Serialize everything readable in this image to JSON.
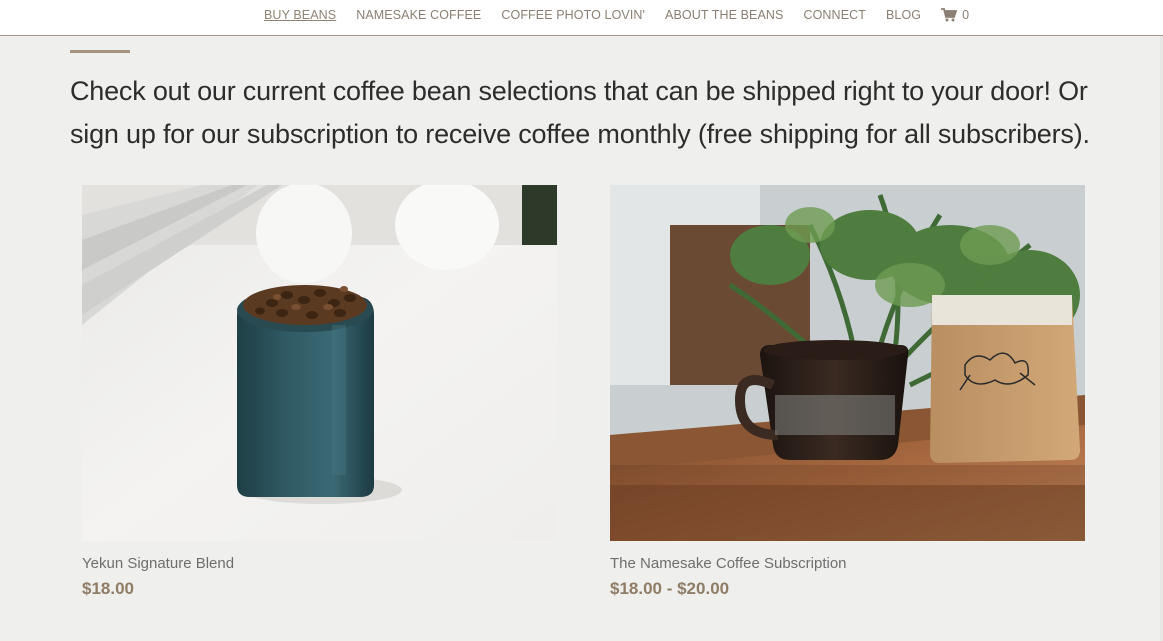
{
  "nav": {
    "items": [
      {
        "label": "BUY BEANS",
        "active": true
      },
      {
        "label": "NAMESAKE COFFEE",
        "active": false
      },
      {
        "label": "COFFEE PHOTO LOVIN'",
        "active": false
      },
      {
        "label": "ABOUT THE BEANS",
        "active": false
      },
      {
        "label": "CONNECT",
        "active": false
      },
      {
        "label": "BLOG",
        "active": false
      }
    ],
    "cart_icon": "shopping-cart-icon",
    "cart_count": "0"
  },
  "intro_text": "Check out our current coffee bean selections that can be shipped right to your door! Or sign up for our subscription to receive coffee monthly (free shipping for all subscribers).",
  "products": [
    {
      "name": "Yekun Signature Blend",
      "price": "$18.00",
      "image": "blue-ceramic-cup-with-coffee-beans"
    },
    {
      "name": "The Namesake Coffee Subscription",
      "price": "$18.00 - $20.00",
      "image": "mug-and-coffee-bag-on-wood-table"
    }
  ],
  "colors": {
    "accent": "#a6957e",
    "price": "#8f7d66",
    "nav_text": "#8a7f72",
    "background": "#efefed"
  }
}
